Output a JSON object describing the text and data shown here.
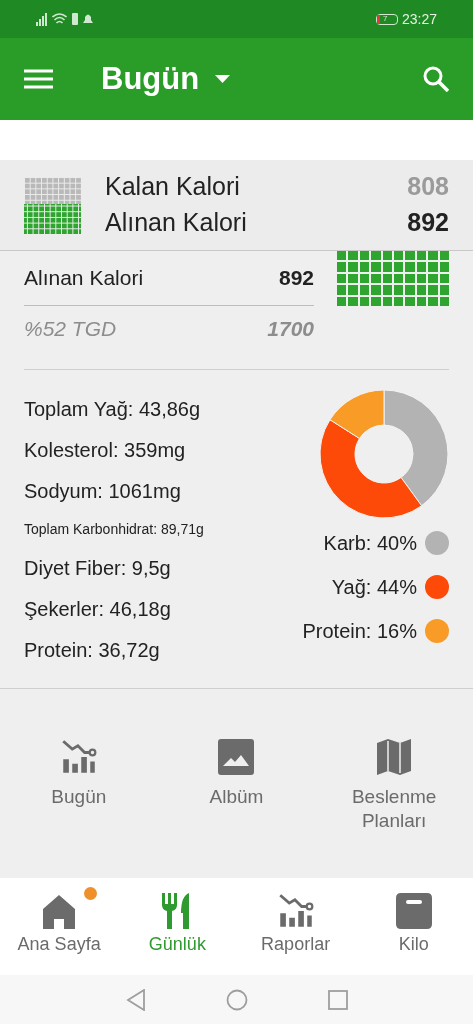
{
  "status_bar": {
    "battery": "7",
    "time": "23:27"
  },
  "app_bar": {
    "title": "Bugün"
  },
  "summary": {
    "rows": [
      {
        "kind": "remaining",
        "label": "Kalan Kalori",
        "value": "808"
      },
      {
        "kind": "consumed",
        "label": "Alınan Kalori",
        "value": "892"
      }
    ]
  },
  "calories": {
    "label": "Alınan Kalori",
    "value": "892",
    "percent": "%52 TGD",
    "goal": "1700"
  },
  "nutrients": [
    {
      "kind": "normal",
      "text": "Toplam Yağ: 43,86g"
    },
    {
      "kind": "normal",
      "text": "Kolesterol: 359mg"
    },
    {
      "kind": "normal",
      "text": "Sodyum: 1061mg"
    },
    {
      "kind": "small",
      "text": "Toplam Karbonhidrat: 89,71g"
    },
    {
      "kind": "normal",
      "text": "Diyet Fiber: 9,5g"
    },
    {
      "kind": "normal",
      "text": "Şekerler: 46,18g"
    },
    {
      "kind": "normal",
      "text": "Protein: 36,72g"
    }
  ],
  "macros": {
    "chart_data": {
      "type": "donut",
      "values": [
        40,
        44,
        16
      ]
    },
    "legend": [
      {
        "label": "Karb: 40%",
        "color": "#b3b3b3"
      },
      {
        "label": "Yağ: 44%",
        "color": "#fd4a08"
      },
      {
        "label": "Protein: 16%",
        "color": "#f99b27"
      }
    ]
  },
  "shortcuts": [
    {
      "kind": "chart",
      "label": "Bugün"
    },
    {
      "kind": "image",
      "label": "Albüm"
    },
    {
      "kind": "map",
      "label": "Beslenme Planları"
    }
  ],
  "bottom_nav": [
    {
      "kind": "home",
      "label": "Ana Sayfa",
      "selected": false,
      "badge": true
    },
    {
      "kind": "food",
      "label": "Günlük",
      "selected": true,
      "badge": false
    },
    {
      "kind": "chart",
      "label": "Raporlar",
      "selected": false,
      "badge": false
    },
    {
      "kind": "scale",
      "label": "Kilo",
      "selected": false,
      "badge": false
    }
  ]
}
